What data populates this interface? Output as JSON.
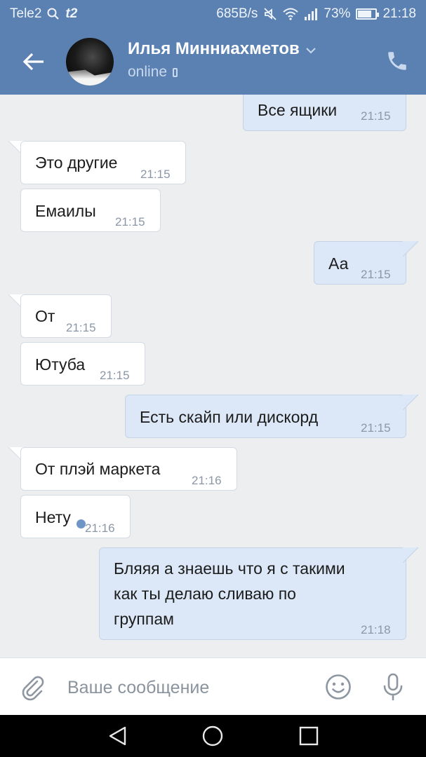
{
  "status_bar": {
    "carrier": "Tele2",
    "carrier2": "t2",
    "speed": "685B/s",
    "battery": "73%",
    "battery_level": 0.73,
    "time": "21:18"
  },
  "header": {
    "contact_name": "Илья Минниахметов",
    "presence": "online"
  },
  "messages": [
    {
      "direction": "out",
      "text": "Все ящики",
      "time": "21:15"
    },
    {
      "direction": "in",
      "text": "Это другие",
      "time": "21:15"
    },
    {
      "direction": "in",
      "text": "Емаилы",
      "time": "21:15"
    },
    {
      "direction": "out",
      "text": "Аа",
      "time": "21:15"
    },
    {
      "direction": "in",
      "text": "От",
      "time": "21:15"
    },
    {
      "direction": "in",
      "text": "Ютуба",
      "time": "21:15"
    },
    {
      "direction": "out",
      "text": "Есть скайп или дискорд",
      "time": "21:15"
    },
    {
      "direction": "in",
      "text": "От плэй маркета",
      "time": "21:16"
    },
    {
      "direction": "in",
      "text": "Нету",
      "time": "21:16"
    },
    {
      "direction": "out",
      "lines": [
        "Бляяя а знаешь что я с  такими",
        "как ты делаю сливаю по",
        "группам"
      ],
      "time": "21:18",
      "unread": true
    }
  ],
  "composer": {
    "placeholder": "Ваше сообщение",
    "value": ""
  },
  "icons": {
    "back": "arrow-left-icon",
    "call": "phone-icon",
    "attach": "paperclip-icon",
    "emoji": "smile-icon",
    "mic": "microphone-icon",
    "nav_back": "triangle-back-icon",
    "nav_home": "circle-home-icon",
    "nav_recents": "square-recents-icon"
  },
  "colors": {
    "header": "#5b81b3",
    "incoming_bubble": "#ffffff",
    "outgoing_bubble": "#dce8f7",
    "background": "#edeef0",
    "unread_dot": "#6f95c6"
  }
}
